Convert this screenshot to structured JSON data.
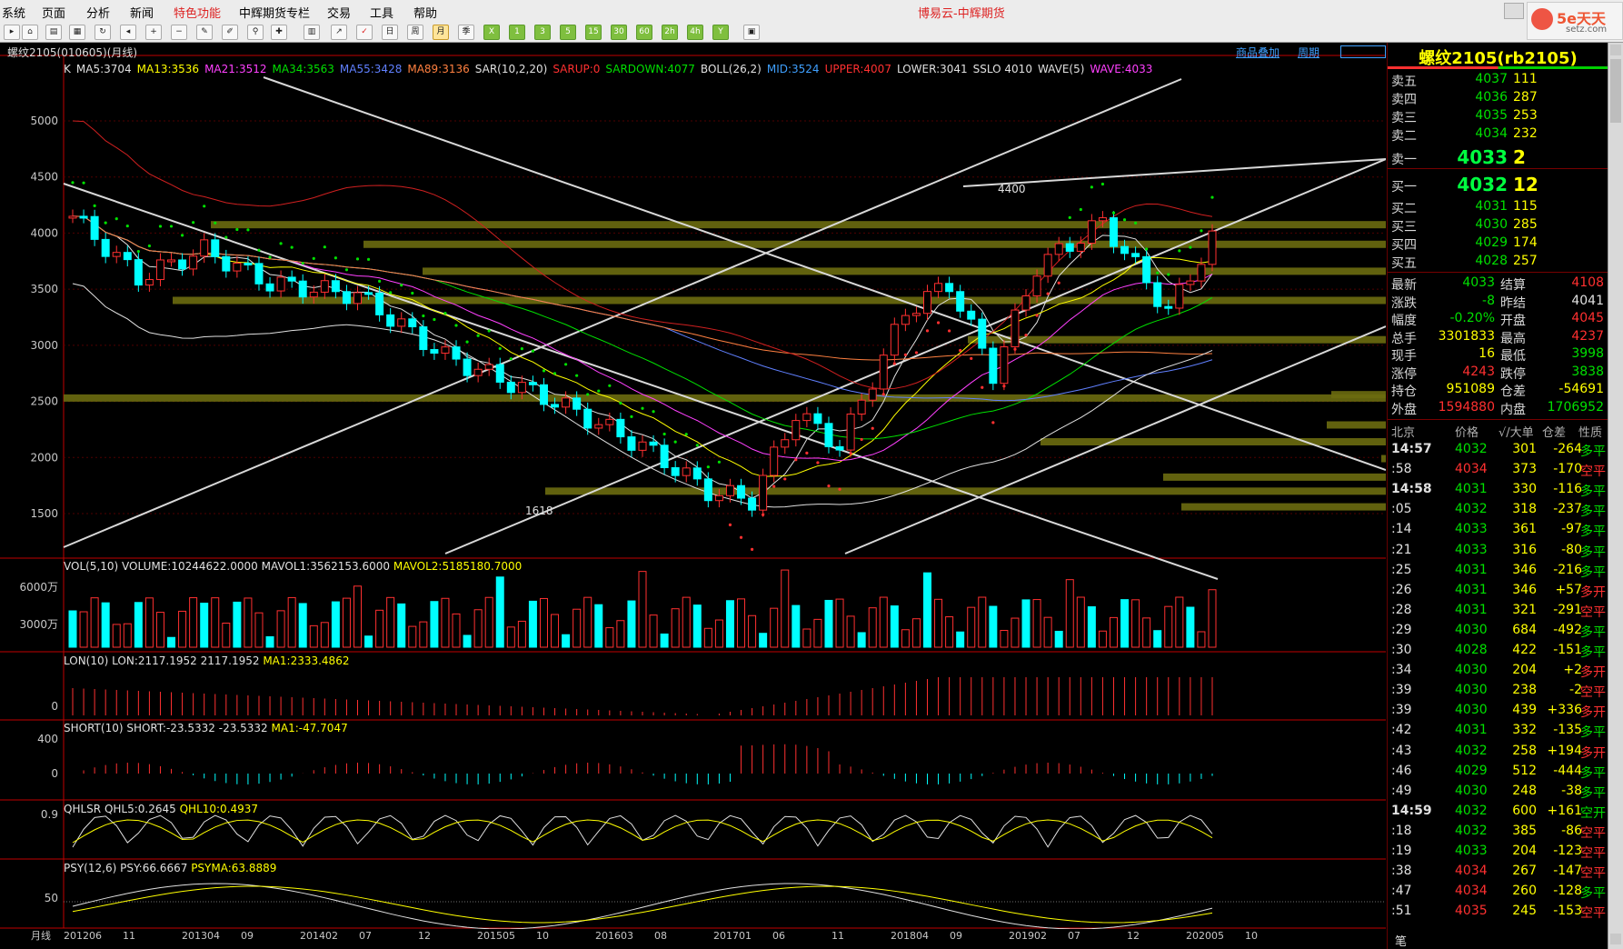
{
  "app": {
    "title": "博易云-中辉期货",
    "menu": [
      "系统",
      "页面",
      "分析",
      "新闻",
      "特色功能",
      "中辉期货专栏",
      "交易",
      "工具",
      "帮助"
    ],
    "toolbar": [
      "日",
      "周",
      "月",
      "季",
      "X",
      "1",
      "3",
      "5",
      "15",
      "30",
      "60",
      "2h",
      "4h",
      "Y"
    ],
    "logo_text": "5e天天",
    "logo_sub": "setz.com"
  },
  "chart": {
    "symbol_label": "螺纹2105(010605)(月线)",
    "links": [
      "商品叠加",
      "周期"
    ],
    "period_label": "月线",
    "main_indicators": [
      {
        "text": "K",
        "color": "#e0e0e0"
      },
      {
        "text": "MA5:3704",
        "color": "#e0e0e0"
      },
      {
        "text": "MA13:3536",
        "color": "#ffff00"
      },
      {
        "text": "MA21:3512",
        "color": "#ff40ff"
      },
      {
        "text": "MA34:3563",
        "color": "#00e000"
      },
      {
        "text": "MA55:3428",
        "color": "#6080ff"
      },
      {
        "text": "MA89:3136",
        "color": "#ff8040"
      },
      {
        "text": "SAR(10,2,20)",
        "color": "#e0e0e0"
      },
      {
        "text": "SARUP:0",
        "color": "#ff3030"
      },
      {
        "text": "SARDOWN:4077",
        "color": "#00e000"
      },
      {
        "text": "BOLL(26,2)",
        "color": "#e0e0e0"
      },
      {
        "text": "MID:3524",
        "color": "#3fa0ff"
      },
      {
        "text": "UPPER:4007",
        "color": "#ff3030"
      },
      {
        "text": "LOWER:3041",
        "color": "#e0e0e0"
      },
      {
        "text": "SSLO 4010",
        "color": "#e0e0e0"
      },
      {
        "text": "WAVE(5)",
        "color": "#e0e0e0"
      },
      {
        "text": "WAVE:4033",
        "color": "#ff40ff"
      }
    ],
    "price_axis": [
      "5000",
      "4500",
      "4000",
      "3500",
      "3000",
      "2500",
      "2000",
      "1500"
    ],
    "annotations": {
      "high": "4400",
      "low": "1618"
    },
    "vol": {
      "label": "VOL(5,10)",
      "volume": "VOLUME:10244622.0000",
      "mavol1": "MAVOL1:3562153.6000",
      "mavol2": "MAVOL2:5185180.7000",
      "axis": [
        "6000万",
        "3000万"
      ]
    },
    "lon": {
      "label": "LON(10)",
      "v1": "LON:2117.1952",
      "v2": "2117.1952",
      "ma": "MA1:2333.4862",
      "axis": [
        "0"
      ]
    },
    "short": {
      "label": "SHORT(10)",
      "v1": "SHORT:-23.5332",
      "v2": "-23.5332",
      "ma": "MA1:-47.7047",
      "axis": [
        "400",
        "0"
      ]
    },
    "qhlsr": {
      "label": "QHLSR",
      "v1": "QHL5:0.2645",
      "ma": "QHL10:0.4937",
      "axis": [
        "0.9"
      ]
    },
    "psy": {
      "label": "PSY(12,6)",
      "v1": "PSY:66.6667",
      "ma": "PSYMA:63.8889",
      "axis": [
        "50"
      ]
    },
    "dates": [
      "201206",
      "11",
      "201304",
      "09",
      "201402",
      "07",
      "12",
      "201505",
      "10",
      "201603",
      "08",
      "201701",
      "06",
      "11",
      "201804",
      "09",
      "201902",
      "07",
      "12",
      "202005",
      "10"
    ]
  },
  "quote": {
    "title": "螺纹2105(rb2105)",
    "sell": [
      {
        "label": "卖五",
        "price": "4037",
        "vol": "111"
      },
      {
        "label": "卖四",
        "price": "4036",
        "vol": "287"
      },
      {
        "label": "卖三",
        "price": "4035",
        "vol": "253"
      },
      {
        "label": "卖二",
        "price": "4034",
        "vol": "232"
      },
      {
        "label": "卖一",
        "price": "4033",
        "vol": "2"
      }
    ],
    "buy": [
      {
        "label": "买一",
        "price": "4032",
        "vol": "12"
      },
      {
        "label": "买二",
        "price": "4031",
        "vol": "115"
      },
      {
        "label": "买三",
        "price": "4030",
        "vol": "285"
      },
      {
        "label": "买四",
        "price": "4029",
        "vol": "174"
      },
      {
        "label": "买五",
        "price": "4028",
        "vol": "257"
      }
    ],
    "stats": [
      {
        "l1": "最新",
        "v1": "4033",
        "c1": "#00e000",
        "l2": "结算",
        "v2": "4108",
        "c2": "#ff3030"
      },
      {
        "l1": "涨跌",
        "v1": "-8",
        "c1": "#00e000",
        "l2": "昨结",
        "v2": "4041",
        "c2": "#e0e0e0"
      },
      {
        "l1": "幅度",
        "v1": "-0.20%",
        "c1": "#00e000",
        "l2": "开盘",
        "v2": "4045",
        "c2": "#ff3030"
      },
      {
        "l1": "总手",
        "v1": "3301833",
        "c1": "#ffff00",
        "l2": "最高",
        "v2": "4237",
        "c2": "#ff3030"
      },
      {
        "l1": "现手",
        "v1": "16",
        "c1": "#ffff00",
        "l2": "最低",
        "v2": "3998",
        "c2": "#00e000"
      },
      {
        "l1": "涨停",
        "v1": "4243",
        "c1": "#ff3030",
        "l2": "跌停",
        "v2": "3838",
        "c2": "#00e000"
      },
      {
        "l1": "持仓",
        "v1": "951089",
        "c1": "#ffff00",
        "l2": "仓差",
        "v2": "-54691",
        "c2": "#ffff00"
      },
      {
        "l1": "外盘",
        "v1": "1594880",
        "c1": "#ff3030",
        "l2": "内盘",
        "v2": "1706952",
        "c2": "#00e000"
      }
    ],
    "tick_header": [
      "北京",
      "价格",
      "√/大单",
      "仓差",
      "性质"
    ],
    "ticks": [
      {
        "t": "14:57",
        "p": "4032",
        "pc": "#00e000",
        "v": "301",
        "d": "-264",
        "n": "多平",
        "nc": "#00e000",
        "bold": true
      },
      {
        "t": ":58",
        "p": "4034",
        "pc": "#ff3030",
        "v": "373",
        "d": "-170",
        "n": "空平",
        "nc": "#ff3030",
        "bold": false
      },
      {
        "t": "14:58",
        "p": "4031",
        "pc": "#00e000",
        "v": "330",
        "d": "-116",
        "n": "多平",
        "nc": "#00e000",
        "bold": true
      },
      {
        "t": ":05",
        "p": "4032",
        "pc": "#00e000",
        "v": "318",
        "d": "-237",
        "n": "多平",
        "nc": "#00e000",
        "bold": false
      },
      {
        "t": ":14",
        "p": "4033",
        "pc": "#00e000",
        "v": "361",
        "d": "-97",
        "n": "多平",
        "nc": "#00e000",
        "bold": false
      },
      {
        "t": ":21",
        "p": "4033",
        "pc": "#00e000",
        "v": "316",
        "d": "-80",
        "n": "多平",
        "nc": "#00e000",
        "bold": false
      },
      {
        "t": ":25",
        "p": "4031",
        "pc": "#00e000",
        "v": "346",
        "d": "-216",
        "n": "多平",
        "nc": "#00e000",
        "bold": false
      },
      {
        "t": ":26",
        "p": "4031",
        "pc": "#00e000",
        "v": "346",
        "d": "+57",
        "n": "多开",
        "nc": "#ff3030",
        "bold": false
      },
      {
        "t": ":28",
        "p": "4031",
        "pc": "#00e000",
        "v": "321",
        "d": "-291",
        "n": "空平",
        "nc": "#ff3030",
        "bold": false
      },
      {
        "t": ":29",
        "p": "4030",
        "pc": "#00e000",
        "v": "684",
        "d": "-492",
        "n": "多平",
        "nc": "#00e000",
        "bold": false
      },
      {
        "t": ":30",
        "p": "4028",
        "pc": "#00e000",
        "v": "422",
        "d": "-151",
        "n": "多平",
        "nc": "#00e000",
        "bold": false
      },
      {
        "t": ":34",
        "p": "4030",
        "pc": "#00e000",
        "v": "204",
        "d": "+2",
        "n": "多开",
        "nc": "#ff3030",
        "bold": false
      },
      {
        "t": ":39",
        "p": "4030",
        "pc": "#00e000",
        "v": "238",
        "d": "-2",
        "n": "空平",
        "nc": "#ff3030",
        "bold": false
      },
      {
        "t": ":39",
        "p": "4030",
        "pc": "#00e000",
        "v": "439",
        "d": "+336",
        "n": "多开",
        "nc": "#ff3030",
        "bold": false
      },
      {
        "t": ":42",
        "p": "4031",
        "pc": "#00e000",
        "v": "332",
        "d": "-135",
        "n": "多平",
        "nc": "#00e000",
        "bold": false
      },
      {
        "t": ":43",
        "p": "4032",
        "pc": "#00e000",
        "v": "258",
        "d": "+194",
        "n": "多开",
        "nc": "#ff3030",
        "bold": false
      },
      {
        "t": ":46",
        "p": "4029",
        "pc": "#00e000",
        "v": "512",
        "d": "-444",
        "n": "多平",
        "nc": "#00e000",
        "bold": false
      },
      {
        "t": ":49",
        "p": "4030",
        "pc": "#00e000",
        "v": "248",
        "d": "-38",
        "n": "多平",
        "nc": "#00e000",
        "bold": false
      },
      {
        "t": "14:59",
        "p": "4032",
        "pc": "#00e000",
        "v": "600",
        "d": "+161",
        "n": "空开",
        "nc": "#00e000",
        "bold": true
      },
      {
        "t": ":18",
        "p": "4032",
        "pc": "#00e000",
        "v": "385",
        "d": "-86",
        "n": "空平",
        "nc": "#ff3030",
        "bold": false
      },
      {
        "t": ":19",
        "p": "4033",
        "pc": "#00e000",
        "v": "204",
        "d": "-123",
        "n": "空平",
        "nc": "#ff3030",
        "bold": false
      },
      {
        "t": ":38",
        "p": "4034",
        "pc": "#ff3030",
        "v": "267",
        "d": "-147",
        "n": "空平",
        "nc": "#ff3030",
        "bold": false
      },
      {
        "t": ":47",
        "p": "4034",
        "pc": "#ff3030",
        "v": "260",
        "d": "-128",
        "n": "多平",
        "nc": "#00e000",
        "bold": false
      },
      {
        "t": ":51",
        "p": "4035",
        "pc": "#ff3030",
        "v": "245",
        "d": "-153",
        "n": "空平",
        "nc": "#ff3030",
        "bold": false
      }
    ],
    "bottom_label": "笔"
  }
}
